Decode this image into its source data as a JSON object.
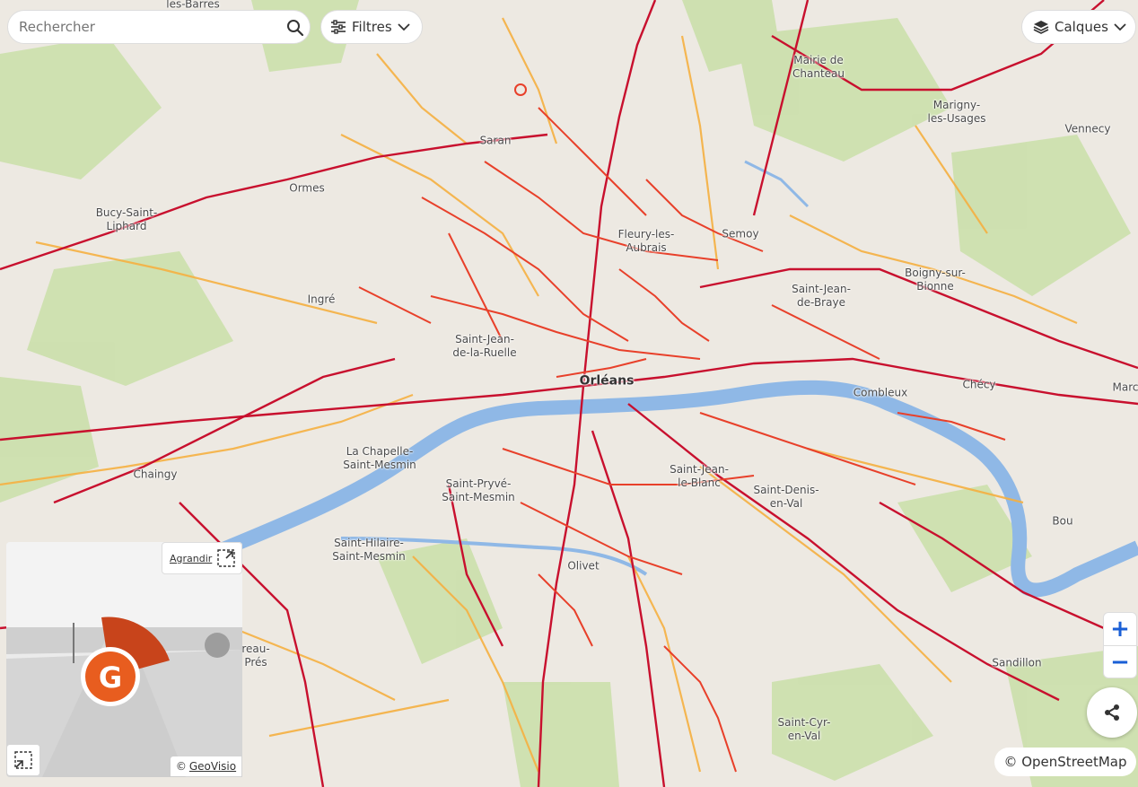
{
  "search": {
    "placeholder": "Rechercher"
  },
  "toolbar": {
    "filters_label": "Filtres",
    "layers_label": "Calques"
  },
  "map": {
    "places": [
      {
        "name": "Orléans",
        "cls": "city"
      },
      {
        "name": "Saran"
      },
      {
        "name": "Ormes"
      },
      {
        "name": "Bucy-Saint-\nLiphard"
      },
      {
        "name": "Ingré"
      },
      {
        "name": "Mairie de\nChanteau"
      },
      {
        "name": "Marigny-\nles-Usages"
      },
      {
        "name": "Vennecy"
      },
      {
        "name": "Semoy"
      },
      {
        "name": "Fleury-les-\nAubrais"
      },
      {
        "name": "Boigny-sur-\nBionne"
      },
      {
        "name": "Saint-Jean-\nde-Braye"
      },
      {
        "name": "Saint-Jean-\nde-la-Ruelle"
      },
      {
        "name": "Combleux"
      },
      {
        "name": "Chécy"
      },
      {
        "name": "Marc"
      },
      {
        "name": "La Chapelle-\nSaint-Mesmin"
      },
      {
        "name": "Chaingy"
      },
      {
        "name": "Saint-Pryvé-\nSaint-Mesmin"
      },
      {
        "name": "Saint-Jean-\nle-Blanc"
      },
      {
        "name": "Saint-Denis-\nen-Val"
      },
      {
        "name": "Bou"
      },
      {
        "name": "Saint-Hilaire-\nSaint-Mesmin"
      },
      {
        "name": "Olivet"
      },
      {
        "name": "Sandillon"
      },
      {
        "name": "Saint-Cyr-\nen-Val"
      },
      {
        "name": "les-Barres"
      },
      {
        "name": "reau-\nPrés"
      }
    ]
  },
  "zoom": {
    "in_label": "+",
    "out_label": "−"
  },
  "attribution": {
    "osm": "© OpenStreetMap"
  },
  "picture_viewer": {
    "expand_label": "Agrandir",
    "credit_prefix": "©",
    "credit_link": "GeoVisio"
  },
  "colors": {
    "road_high": "#c8102e",
    "road_mid": "#e8402a",
    "road_low": "#f5b041",
    "water": "#8fb8e6",
    "green": "#c9dfa8"
  }
}
